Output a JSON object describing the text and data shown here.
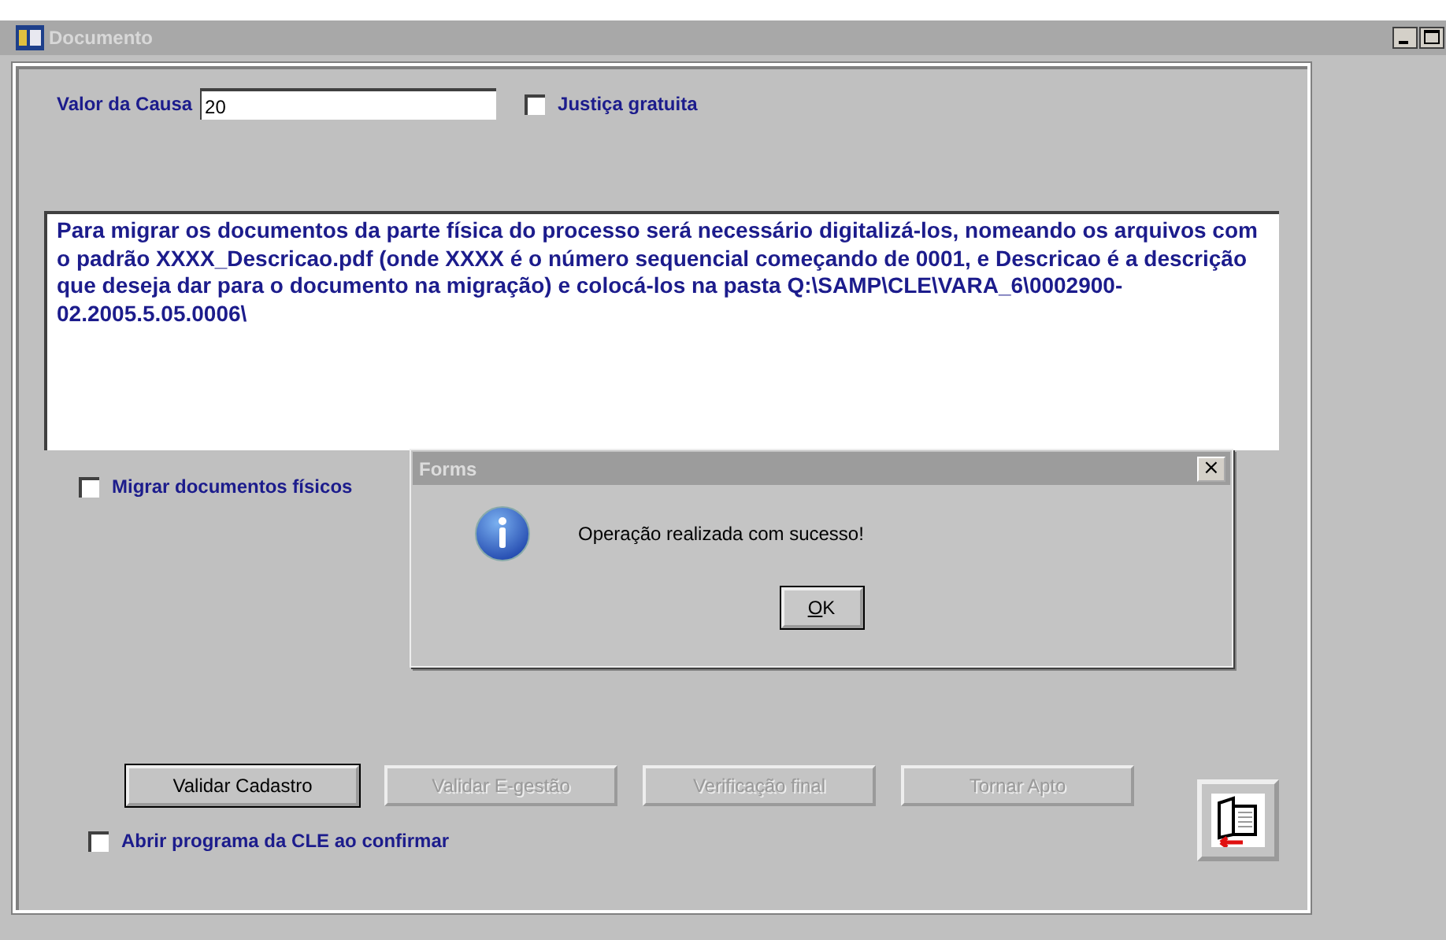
{
  "window": {
    "title": "Documento"
  },
  "form": {
    "valor_label": "Valor da Causa",
    "valor_value": "20",
    "justica": {
      "label": "Justiça gratuita",
      "checked": false
    },
    "info_text": "Para migrar os documentos da parte física do processo será necessário digitalizá-los, nomeando os arquivos com o padrão XXXX_Descricao.pdf (onde XXXX é o número sequencial começando de 0001, e Descricao é a descrição que deseja dar para o documento na migração) e colocá-los na pasta Q:\\SAMP\\CLE\\VARA_6\\0002900-02.2005.5.05.0006\\",
    "migrar": {
      "label": "Migrar documentos físicos",
      "checked": false
    },
    "buttons": [
      {
        "label": "Validar Cadastro",
        "disabled": false,
        "default": true
      },
      {
        "label": "Validar E-gestão",
        "disabled": true,
        "default": false
      },
      {
        "label": "Verificação final",
        "disabled": true,
        "default": false
      },
      {
        "label": "Tornar Apto",
        "disabled": true,
        "default": false
      }
    ],
    "abrir": {
      "label": "Abrir programa da CLE ao confirmar",
      "checked": false
    }
  },
  "dialog": {
    "title": "Forms",
    "close": "×",
    "message": "Operação realizada com sucesso!",
    "ok": "OK"
  }
}
